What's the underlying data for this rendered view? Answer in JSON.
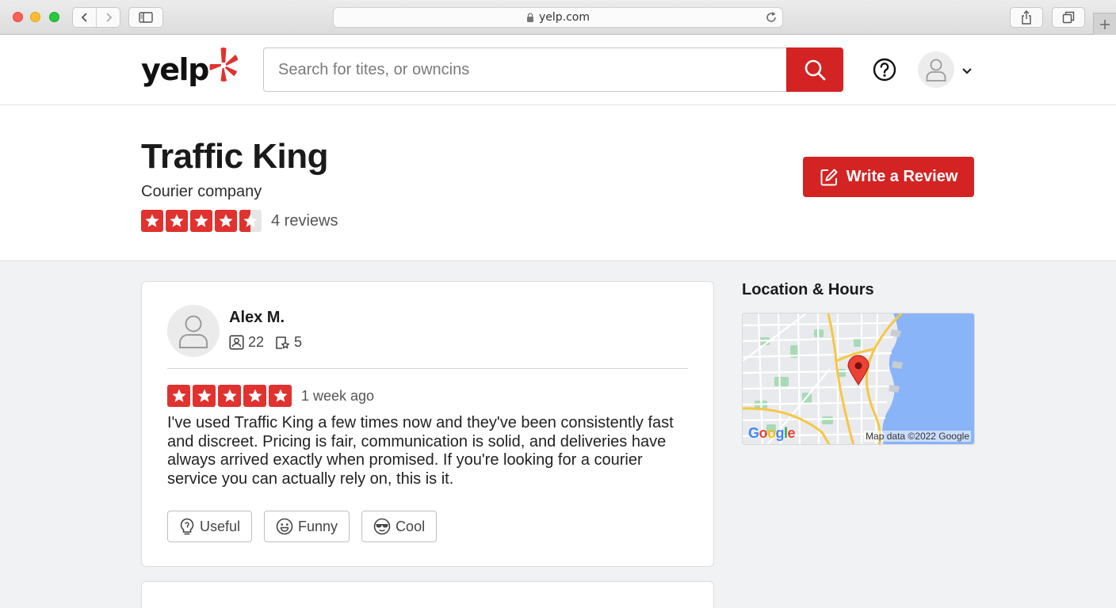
{
  "browser": {
    "url": "yelp.com"
  },
  "header": {
    "logo_text": "yelp",
    "search_placeholder": "Search for tites, or owncins"
  },
  "business": {
    "name": "Traffic King",
    "category": "Courier company",
    "rating": 4.5,
    "review_count_label": "4 reviews",
    "write_review_label": "Write a Review"
  },
  "review": {
    "user_name": "Alex M.",
    "friends_count": "22",
    "reviews_count": "5",
    "rating": 5,
    "date": "1 week ago",
    "text": "I've used Traffic King a few times now and they've been consistently fast and discreet. Pricing is fair, communication is solid, and deliveries have always arrived exactly when promised. If you're looking for a courier service you can actually rely on, this is it.",
    "reactions": [
      {
        "label": "Useful",
        "icon": "lightbulb-icon"
      },
      {
        "label": "Funny",
        "icon": "smile-icon"
      },
      {
        "label": "Cool",
        "icon": "sunglasses-icon"
      }
    ]
  },
  "location": {
    "title": "Location & Hours",
    "map_logo": "Google",
    "map_attribution": "Map data ©2022 Google"
  },
  "colors": {
    "brand_red": "#d32323",
    "star_red": "#e0322f"
  }
}
